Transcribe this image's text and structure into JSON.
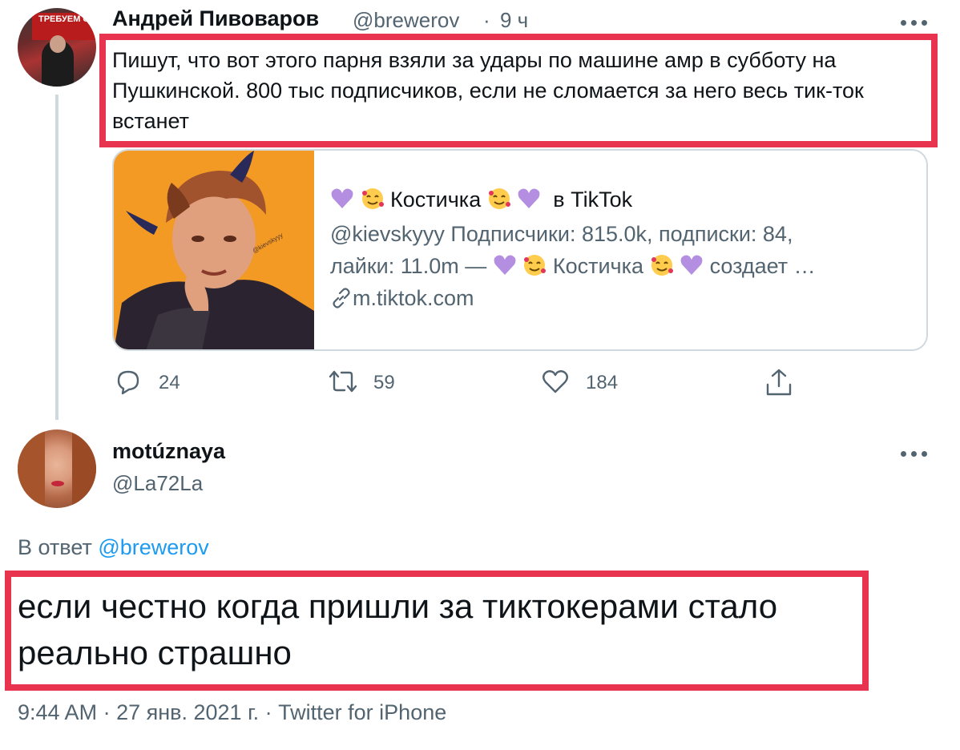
{
  "tweet1": {
    "author_name": "Андрей Пивоваров",
    "handle": "@brewerov",
    "separator": "·",
    "time": "9 ч",
    "avatar_sign_text": "ТРЕБУЕМ СВОБОДЫ",
    "text": "Пишут, что вот этого парня взяли за удары по машине амр в субботу на Пушкинской. 800 тыс подписчиков, если не сломается за него весь тик-ток встанет",
    "card": {
      "title_name": "Костичка",
      "title_suffix": "в TikTok",
      "description_line1": "@kievskyyy Подписчики: 815.0k, подписки: 84,",
      "description_line2_a": "лайки: 11.0m —",
      "description_line2_name": "Костичка",
      "description_line2_b": "создает …",
      "domain": "m.tiktok.com",
      "image_watermark": "@kievskyyy"
    },
    "actions": {
      "replies": "24",
      "retweets": "59",
      "likes": "184"
    }
  },
  "tweet2": {
    "author_name": "motúznaya",
    "handle": "@La72La",
    "reply_prefix": "В ответ",
    "reply_mention": "@brewerov",
    "text": "если честно когда пришли за тиктокерами стало реально страшно",
    "time": "9:44 AM",
    "separator": "·",
    "date": "27 янв. 2021 г.",
    "source": "Twitter for iPhone"
  },
  "colors": {
    "highlight": "#e8344e",
    "link": "#1d9bf0",
    "secondary_text": "#536471",
    "card_image_bg": "#f39a25",
    "heart_emoji": "#b48ee0"
  },
  "icons": [
    "reply-icon",
    "retweet-icon",
    "like-icon",
    "share-icon",
    "more-icon",
    "link-icon",
    "purple-heart-icon",
    "smiling-face-with-hearts-icon"
  ]
}
